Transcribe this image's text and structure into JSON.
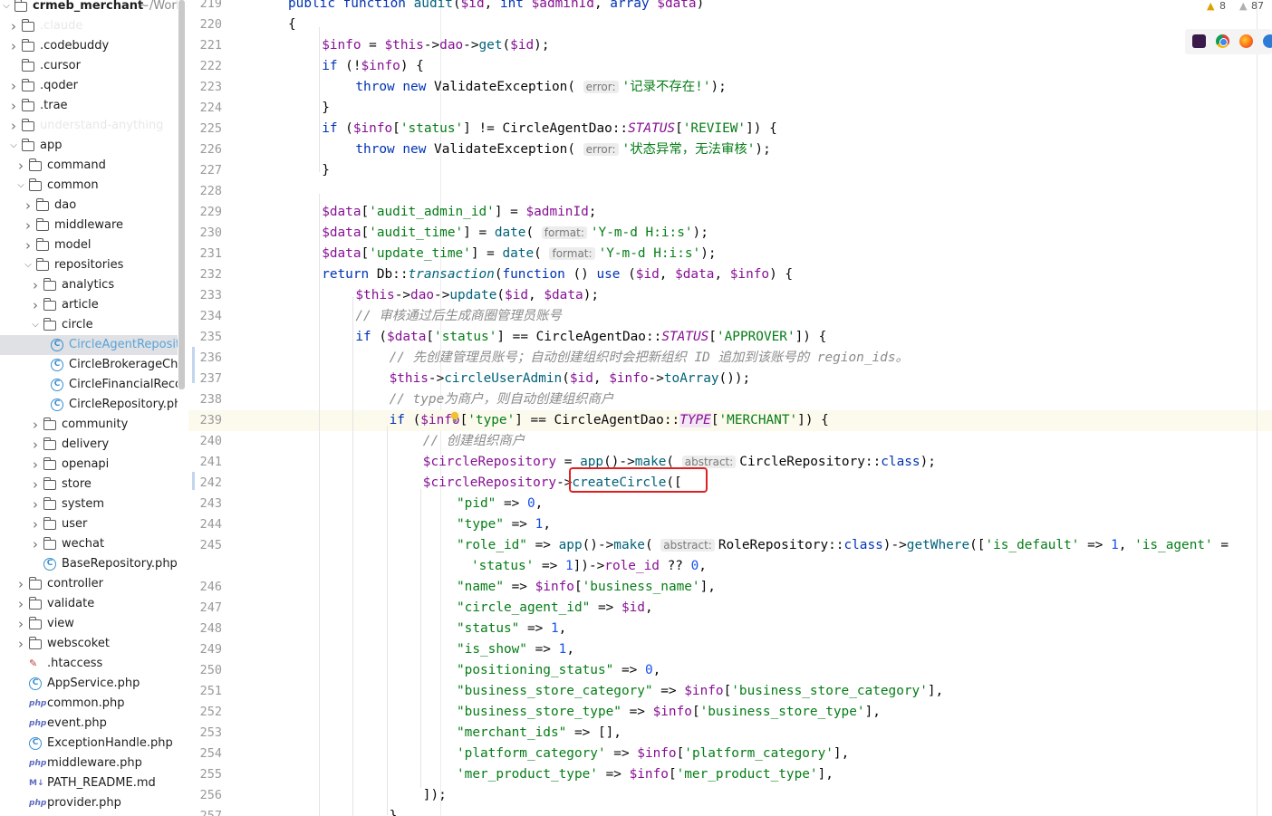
{
  "project": {
    "name": "crmeb_merchant",
    "path_hint": "~/Work"
  },
  "tree": [
    {
      "label": "crmeb_merchant",
      "level": 0,
      "type": "folder",
      "expanded": true,
      "hint": "~/Work"
    },
    {
      "label": ".claude",
      "level": 1,
      "type": "folder",
      "faded": true
    },
    {
      "label": ".codebuddy",
      "level": 1,
      "type": "folder"
    },
    {
      "label": ".cursor",
      "level": 1,
      "type": "folder",
      "nochev": true
    },
    {
      "label": ".qoder",
      "level": 1,
      "type": "folder"
    },
    {
      "label": ".trae",
      "level": 1,
      "type": "folder"
    },
    {
      "label": "understand-anything",
      "level": 1,
      "type": "folder",
      "faded": true
    },
    {
      "label": "app",
      "level": 1,
      "type": "folder",
      "expanded": true
    },
    {
      "label": "command",
      "level": 2,
      "type": "folder"
    },
    {
      "label": "common",
      "level": 2,
      "type": "folder",
      "expanded": true
    },
    {
      "label": "dao",
      "level": 3,
      "type": "folder"
    },
    {
      "label": "middleware",
      "level": 3,
      "type": "folder"
    },
    {
      "label": "model",
      "level": 3,
      "type": "folder"
    },
    {
      "label": "repositories",
      "level": 3,
      "type": "folder",
      "expanded": true
    },
    {
      "label": "analytics",
      "level": 4,
      "type": "folder"
    },
    {
      "label": "article",
      "level": 4,
      "type": "folder"
    },
    {
      "label": "circle",
      "level": 4,
      "type": "folder",
      "expanded": true
    },
    {
      "label": "CircleAgentRepository.php",
      "level": 5,
      "type": "class",
      "selected": true
    },
    {
      "label": "CircleBrokerageChe",
      "level": 5,
      "type": "class"
    },
    {
      "label": "CircleFinancialReco",
      "level": 5,
      "type": "class"
    },
    {
      "label": "CircleRepository.ph",
      "level": 5,
      "type": "class"
    },
    {
      "label": "community",
      "level": 4,
      "type": "folder"
    },
    {
      "label": "delivery",
      "level": 4,
      "type": "folder"
    },
    {
      "label": "openapi",
      "level": 4,
      "type": "folder"
    },
    {
      "label": "store",
      "level": 4,
      "type": "folder"
    },
    {
      "label": "system",
      "level": 4,
      "type": "folder"
    },
    {
      "label": "user",
      "level": 4,
      "type": "folder"
    },
    {
      "label": "wechat",
      "level": 4,
      "type": "folder"
    },
    {
      "label": "BaseRepository.php",
      "level": 4,
      "type": "class"
    },
    {
      "label": "controller",
      "level": 2,
      "type": "folder"
    },
    {
      "label": "validate",
      "level": 2,
      "type": "folder"
    },
    {
      "label": "view",
      "level": 2,
      "type": "folder"
    },
    {
      "label": "webscoket",
      "level": 2,
      "type": "folder"
    },
    {
      "label": ".htaccess",
      "level": 2,
      "type": "htaccess"
    },
    {
      "label": "AppService.php",
      "level": 2,
      "type": "class"
    },
    {
      "label": "common.php",
      "level": 2,
      "type": "php"
    },
    {
      "label": "event.php",
      "level": 2,
      "type": "php"
    },
    {
      "label": "ExceptionHandle.php",
      "level": 2,
      "type": "class"
    },
    {
      "label": "middleware.php",
      "level": 2,
      "type": "php"
    },
    {
      "label": "PATH_README.md",
      "level": 2,
      "type": "md"
    },
    {
      "label": "provider.php",
      "level": 2,
      "type": "php"
    }
  ],
  "inspections": {
    "warnings": "8",
    "weak_warnings": "87"
  },
  "editor": {
    "highlighted_line": "239",
    "lines": [
      {
        "n": "219",
        "html": "<span class=\"kw\">public function</span> <span class=\"fn\">audit</span>(<span class=\"var\">$id</span>, <span class=\"kw\">int</span> <span class=\"var\">$adminId</span>, <span class=\"kw\">array</span> <span class=\"var\">$data</span>)",
        "indent": 0
      },
      {
        "n": "220",
        "html": "{",
        "indent": 0
      },
      {
        "n": "221",
        "html": "<span class=\"var\">$info</span> = <span class=\"var\">$this</span>-><span class=\"var\">dao</span>-><span class=\"fn\">get</span>(<span class=\"var\">$id</span>);",
        "indent": 1
      },
      {
        "n": "222",
        "html": "<span class=\"kw\">if</span> (!<span class=\"var\">$info</span>) {",
        "indent": 1
      },
      {
        "n": "223",
        "html": "<span class=\"kw\">throw new</span> ValidateException( <span class=\"hint-chip\">error:</span><span class=\"str\">'记录不存在!'</span>);",
        "indent": 2
      },
      {
        "n": "224",
        "html": "}",
        "indent": 1
      },
      {
        "n": "225",
        "html": "<span class=\"kw\">if</span> (<span class=\"var\">$info</span>[<span class=\"str\">'status'</span>] != CircleAgentDao::<span class=\"const\">STATUS</span>[<span class=\"str\">'REVIEW'</span>]) {",
        "indent": 1
      },
      {
        "n": "226",
        "html": "<span class=\"kw\">throw new</span> ValidateException( <span class=\"hint-chip\">error:</span><span class=\"str\">'状态异常，无法审核'</span>);",
        "indent": 2
      },
      {
        "n": "227",
        "html": "}",
        "indent": 1
      },
      {
        "n": "228",
        "html": "",
        "indent": 1
      },
      {
        "n": "229",
        "html": "<span class=\"var\">$data</span>[<span class=\"str\">'audit_admin_id'</span>] = <span class=\"var\">$adminId</span>;",
        "indent": 1
      },
      {
        "n": "230",
        "html": "<span class=\"var\">$data</span>[<span class=\"str\">'audit_time'</span>] = <span class=\"fn\">date</span>( <span class=\"hint-chip\">format:</span><span class=\"str\">'Y-m-d H:i:s'</span>);",
        "indent": 1
      },
      {
        "n": "231",
        "html": "<span class=\"var\">$data</span>[<span class=\"str\">'update_time'</span>] = <span class=\"fn\">date</span>( <span class=\"hint-chip\">format:</span><span class=\"str\">'Y-m-d H:i:s'</span>);",
        "indent": 1
      },
      {
        "n": "232",
        "html": "<span class=\"kw\">return</span> Db::<span class=\"fn\" style=\"font-style:italic\">transaction</span>(<span class=\"kw\">function</span> () <span class=\"kw\">use</span> (<span class=\"var\">$id</span>, <span class=\"var\">$data</span>, <span class=\"var\">$info</span>) {",
        "indent": 1
      },
      {
        "n": "233",
        "html": "<span class=\"var\">$this</span>-><span class=\"var\">dao</span>-><span class=\"fn\">update</span>(<span class=\"var\">$id</span>, <span class=\"var\">$data</span>);",
        "indent": 2
      },
      {
        "n": "234",
        "html": "<span class=\"cm\">// 审核通过后生成商圈管理员账号</span>",
        "indent": 2
      },
      {
        "n": "235",
        "html": "<span class=\"kw\">if</span> (<span class=\"var\">$data</span>[<span class=\"str\">'status'</span>] == CircleAgentDao::<span class=\"const\">STATUS</span>[<span class=\"str\">'APPROVER'</span>]) {",
        "indent": 2
      },
      {
        "n": "236",
        "html": "<span class=\"cm\">// 先创建管理员账号；自动创建组织时会把新组织 ID 追加到该账号的 region_ids。</span>",
        "indent": 3
      },
      {
        "n": "237",
        "html": "<span class=\"var\">$this</span>-><span class=\"fn\">circleUserAdmin</span>(<span class=\"var\">$id</span>, <span class=\"var\">$info</span>-><span class=\"fn\">toArray</span>());",
        "indent": 3
      },
      {
        "n": "238",
        "html": "<span class=\"cm\">// type为商户，则自动创建组织商户</span>",
        "indent": 3
      },
      {
        "n": "239",
        "html": "<span class=\"kw\">if</span> (<span class=\"var\">$info</span>[<span class=\"str\">'type'</span>] == CircleAgentDao::<span class=\"const\" style=\"background:#f3e6f5\">TYPE</span>[<span class=\"str\">'MERCHANT'</span>]) {",
        "indent": 3
      },
      {
        "n": "240",
        "html": "<span class=\"cm\">// 创建组织商户</span>",
        "indent": 4
      },
      {
        "n": "241",
        "html": "<span class=\"var\">$circleRepository</span> = <span class=\"fn\">app</span>()-><span class=\"fn\">make</span>( <span class=\"hint-chip\">abstract:</span>CircleRepository::<span class=\"kw\">class</span>);",
        "indent": 4
      },
      {
        "n": "242",
        "html": "<span class=\"var\">$circleRepository</span>-><span class=\"fn\">createCircle</span>([",
        "indent": 4
      },
      {
        "n": "243",
        "html": "<span class=\"str\">\"pid\"</span> => <span class=\"num\">0</span>,",
        "indent": 5
      },
      {
        "n": "244",
        "html": "<span class=\"str\">\"type\"</span> => <span class=\"num\">1</span>,",
        "indent": 5
      },
      {
        "n": "245",
        "html": "<span class=\"str\">\"role_id\"</span> => <span class=\"fn\">app</span>()-><span class=\"fn\">make</span>( <span class=\"hint-chip\">abstract:</span>RoleRepository::<span class=\"kw\">class</span>)-><span class=\"fn\">getWhere</span>([<span class=\"str\">'is_default'</span> => <span class=\"num\">1</span>, <span class=\"str\">'is_agent'</span> =",
        "indent": 5
      },
      {
        "n": "",
        "html": "<span class=\"str\">'status'</span> => <span class=\"num\">1</span>])-><span class=\"var\">role_id</span> ?? <span class=\"num\">0</span>,",
        "indent": 5,
        "extra": 16
      },
      {
        "n": "246",
        "html": "<span class=\"str\">\"name\"</span> => <span class=\"var\">$info</span>[<span class=\"str\">'business_name'</span>],",
        "indent": 5
      },
      {
        "n": "247",
        "html": "<span class=\"str\">\"circle_agent_id\"</span> => <span class=\"var\">$id</span>,",
        "indent": 5
      },
      {
        "n": "248",
        "html": "<span class=\"str\">\"status\"</span> => <span class=\"num\">1</span>,",
        "indent": 5
      },
      {
        "n": "249",
        "html": "<span class=\"str\">\"is_show\"</span> => <span class=\"num\">1</span>,",
        "indent": 5
      },
      {
        "n": "250",
        "html": "<span class=\"str\">\"positioning_status\"</span> => <span class=\"num\">0</span>,",
        "indent": 5
      },
      {
        "n": "251",
        "html": "<span class=\"str\">\"business_store_category\"</span> => <span class=\"var\">$info</span>[<span class=\"str\">'business_store_category'</span>],",
        "indent": 5
      },
      {
        "n": "252",
        "html": "<span class=\"str\">\"business_store_type\"</span> => <span class=\"var\">$info</span>[<span class=\"str\">'business_store_type'</span>],",
        "indent": 5
      },
      {
        "n": "253",
        "html": "<span class=\"str\">\"merchant_ids\"</span> => [],",
        "indent": 5
      },
      {
        "n": "254",
        "html": "<span class=\"str\">'platform_category'</span> => <span class=\"var\">$info</span>[<span class=\"str\">'platform_category'</span>],",
        "indent": 5
      },
      {
        "n": "255",
        "html": "<span class=\"str\">'mer_product_type'</span> => <span class=\"var\">$info</span>[<span class=\"str\">'mer_product_type'</span>],",
        "indent": 5
      },
      {
        "n": "256",
        "html": "]);",
        "indent": 4
      },
      {
        "n": "257",
        "html": "}",
        "indent": 3
      }
    ]
  },
  "icons": {
    "warning": "warning-triangle-icon",
    "weak_warning": "weak-warning-icon",
    "bulb": "lightbulb-icon",
    "browsers": [
      "jetbrains-browser-icon",
      "chrome-icon",
      "firefox-icon",
      "safari-icon"
    ]
  },
  "colors": {
    "accent": "#3a8fd0",
    "highlight_box": "#e02020",
    "current_line": "#fcfaed",
    "selection": "#dfe1e5"
  }
}
